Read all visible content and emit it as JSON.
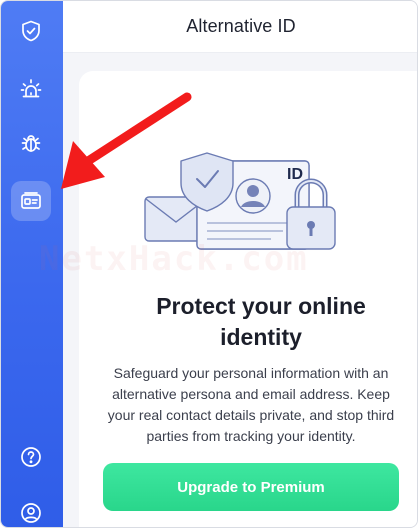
{
  "header": {
    "title": "Alternative ID"
  },
  "sidebar": {
    "items": [
      {
        "icon": "shield-check-icon"
      },
      {
        "icon": "alarm-icon"
      },
      {
        "icon": "bug-icon"
      },
      {
        "icon": "id-card-icon",
        "active": true
      },
      {
        "icon": "help-icon"
      },
      {
        "icon": "account-icon"
      }
    ]
  },
  "main": {
    "illustration": {
      "badge_text": "ID"
    },
    "title_line1": "Protect your online",
    "title_line2": "identity",
    "description": "Safeguard your personal information with an alternative persona and email address. Keep your real contact details private, and stop third parties from tracking your identity.",
    "upgrade_label": "Upgrade to Premium"
  },
  "watermark": "NetxHack.com",
  "colors": {
    "sidebar": "#3b68ee",
    "accent_green": "#2edb8f",
    "annotation_arrow": "#f21c1c"
  }
}
